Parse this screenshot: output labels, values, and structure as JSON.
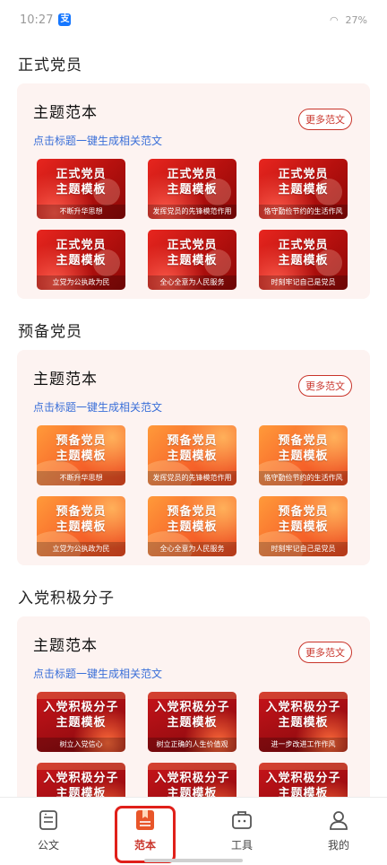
{
  "status_bar": {
    "time": "10:27",
    "battery": "27%"
  },
  "colors": {
    "accent": "#c9342a",
    "link": "#3a6fd8",
    "card_bg": "#fdf3f1"
  },
  "sections": [
    {
      "title": "正式党员",
      "card_title": "主题范本",
      "subtitle": "点击标题一键生成相关范文",
      "more": "更多范文",
      "style": "red",
      "items": [
        {
          "line1": "正式党员",
          "line2": "主题模板",
          "caption": "不断升华思想"
        },
        {
          "line1": "正式党员",
          "line2": "主题模板",
          "caption": "发挥党员的先锋模范作用"
        },
        {
          "line1": "正式党员",
          "line2": "主题模板",
          "caption": "恪守勤俭节约的生活作风"
        },
        {
          "line1": "正式党员",
          "line2": "主题模板",
          "caption": "立党为公执政为民"
        },
        {
          "line1": "正式党员",
          "line2": "主题模板",
          "caption": "全心全意为人民服务"
        },
        {
          "line1": "正式党员",
          "line2": "主题模板",
          "caption": "时刻牢记自己是党员"
        }
      ]
    },
    {
      "title": "预备党员",
      "card_title": "主题范本",
      "subtitle": "点击标题一键生成相关范文",
      "more": "更多范文",
      "style": "orange",
      "items": [
        {
          "line1": "预备党员",
          "line2": "主题模板",
          "caption": "不断升华思想"
        },
        {
          "line1": "预备党员",
          "line2": "主题模板",
          "caption": "发挥党员的先锋模范作用"
        },
        {
          "line1": "预备党员",
          "line2": "主题模板",
          "caption": "恪守勤俭节约的生活作风"
        },
        {
          "line1": "预备党员",
          "line2": "主题模板",
          "caption": "立党为公执政为民"
        },
        {
          "line1": "预备党员",
          "line2": "主题模板",
          "caption": "全心全意为人民服务"
        },
        {
          "line1": "预备党员",
          "line2": "主题模板",
          "caption": "时刻牢记自己是党员"
        }
      ]
    },
    {
      "title": "入党积极分子",
      "card_title": "主题范本",
      "subtitle": "点击标题一键生成相关范文",
      "more": "更多范文",
      "style": "crimson",
      "items": [
        {
          "line1": "入党积极分子",
          "line2": "主题模板",
          "caption": "树立入党信心"
        },
        {
          "line1": "入党积极分子",
          "line2": "主题模板",
          "caption": "树立正确的人生价值观"
        },
        {
          "line1": "入党积极分子",
          "line2": "主题模板",
          "caption": "进一步改进工作作风"
        },
        {
          "line1": "入党积极分子",
          "line2": "主题模板",
          "caption": ""
        },
        {
          "line1": "入党积极分子",
          "line2": "主题模板",
          "caption": ""
        },
        {
          "line1": "入党积极分子",
          "line2": "主题模板",
          "caption": ""
        }
      ]
    }
  ],
  "tabbar": [
    {
      "label": "公文",
      "icon": "document-icon",
      "active": false
    },
    {
      "label": "范本",
      "icon": "book-icon",
      "active": true
    },
    {
      "label": "工具",
      "icon": "toolbox-icon",
      "active": false
    },
    {
      "label": "我的",
      "icon": "user-icon",
      "active": false
    }
  ]
}
